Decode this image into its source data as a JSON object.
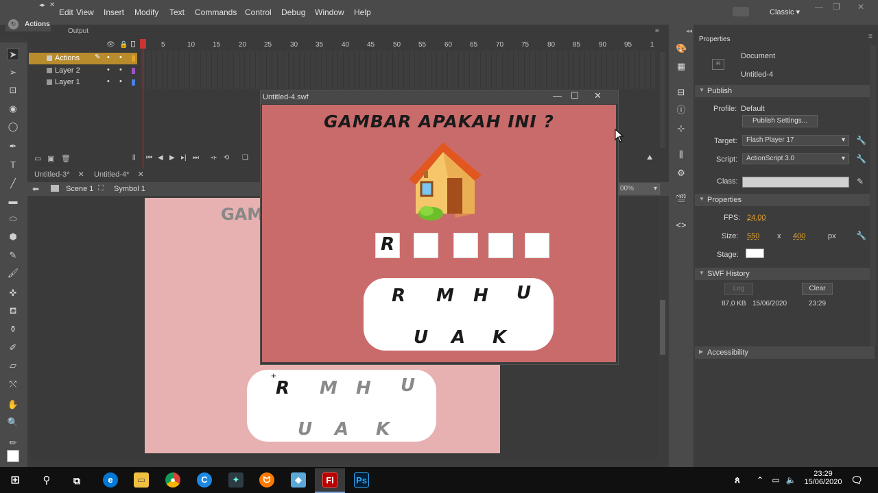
{
  "menubar": {
    "items": [
      "Edit",
      "View",
      "Insert",
      "Modify",
      "Text",
      "Commands",
      "Control",
      "Debug",
      "Window",
      "Help"
    ],
    "workspace": "Classic"
  },
  "actions_panel": {
    "title": "Actions",
    "output_tab": "Output"
  },
  "timeline": {
    "layers": [
      {
        "name": "Actions",
        "color": "#e8a32a"
      },
      {
        "name": "Layer 2",
        "color": "#a050c8"
      },
      {
        "name": "Layer 1",
        "color": "#4a80e0"
      }
    ],
    "frame_numbers": [
      "1",
      "5",
      "10",
      "15",
      "20",
      "25",
      "30",
      "35",
      "40",
      "45",
      "50",
      "55",
      "60",
      "65",
      "70",
      "75",
      "80",
      "85",
      "90",
      "95",
      "1"
    ]
  },
  "document_tabs": [
    {
      "label": "Untitled-3*"
    },
    {
      "label": "Untitled-4*"
    }
  ],
  "breadcrumb": {
    "scene": "Scene 1",
    "symbol": "Symbol 1",
    "zoom": "00%"
  },
  "stage": {
    "title_text": "GAM",
    "letters_row1": [
      "R",
      "M",
      "H",
      "U"
    ],
    "letters_row2": [
      "U",
      "A",
      "K"
    ]
  },
  "swf_window": {
    "title": "Untitled-4.swf",
    "heading": "GAMBAR APAKAH INI ?",
    "answer_slots": [
      "R",
      "",
      "",
      "",
      ""
    ],
    "letters_row1": [
      "R",
      "M",
      "H",
      "U"
    ],
    "letters_row2": [
      "U",
      "A",
      "K"
    ]
  },
  "properties": {
    "tab": "Properties",
    "doc_type": "Document",
    "doc_name": "Untitled-4",
    "publish": {
      "section": "Publish",
      "profile_label": "Profile:",
      "profile_value": "Default",
      "settings_button": "Publish Settings...",
      "target_label": "Target:",
      "target_value": "Flash Player 17",
      "script_label": "Script:",
      "script_value": "ActionScript 3.0",
      "class_label": "Class:"
    },
    "props": {
      "section": "Properties",
      "fps_label": "FPS:",
      "fps_value": "24,00",
      "size_label": "Size:",
      "width": "550",
      "x": "x",
      "height": "400",
      "unit": "px",
      "stage_label": "Stage:",
      "stage_color": "#ffffff"
    },
    "swf_history": {
      "section": "SWF History",
      "log_button": "Log",
      "clear_button": "Clear",
      "size": "87,0 KB",
      "date": "15/06/2020",
      "time": "23:29"
    },
    "accessibility": "Accessibility"
  },
  "taskbar": {
    "time": "23:29",
    "date": "15/06/2020"
  }
}
